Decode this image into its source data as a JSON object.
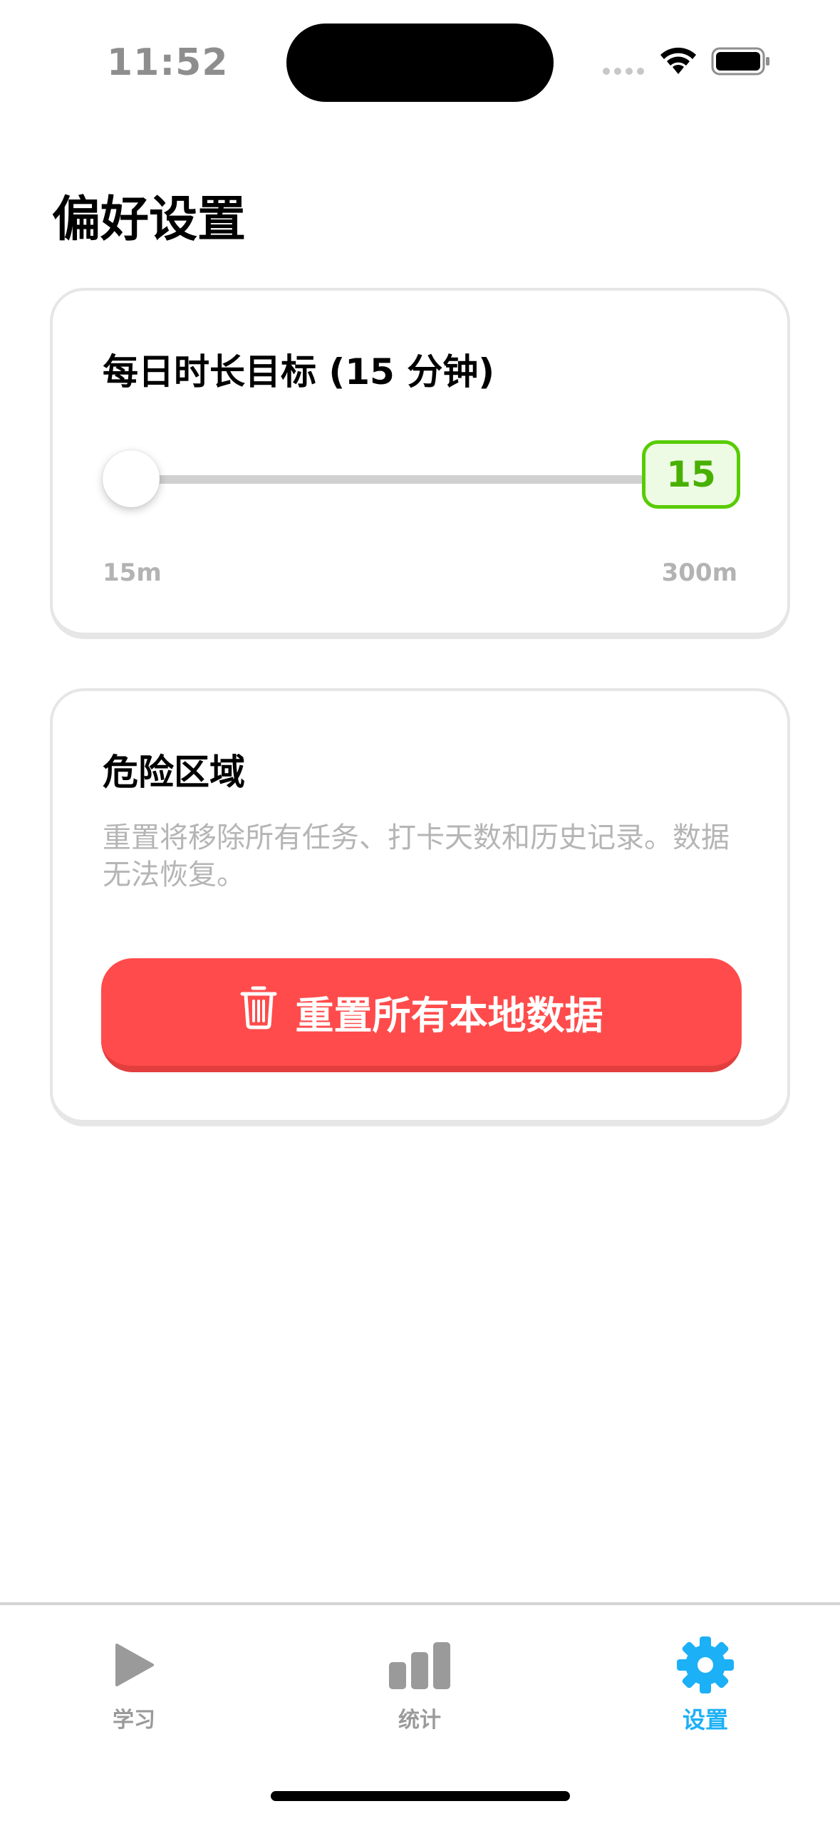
{
  "status_bar": {
    "time": "11:52"
  },
  "page": {
    "title": "偏好设置"
  },
  "daily_goal": {
    "title": "每日时长目标 (15 分钟)",
    "value": 15,
    "value_label": "15",
    "min": 15,
    "max": 300,
    "min_label": "15m",
    "max_label": "300m"
  },
  "danger_zone": {
    "title": "危险区域",
    "description": "重置将移除所有任务、打卡天数和历史记录。数据无法恢复。",
    "reset_button_label": "重置所有本地数据",
    "reset_icon": "trash-icon"
  },
  "tab_bar": {
    "tabs": [
      {
        "label": "学习",
        "icon": "play-icon",
        "active": false
      },
      {
        "label": "统计",
        "icon": "bar-chart-icon",
        "active": false
      },
      {
        "label": "设置",
        "icon": "gear-icon",
        "active": true
      }
    ]
  },
  "colors": {
    "accent_green": "#58cc02",
    "danger_red": "#ff4b4b",
    "active_blue": "#1cb0f6",
    "inactive_gray": "#9a9a9a"
  }
}
